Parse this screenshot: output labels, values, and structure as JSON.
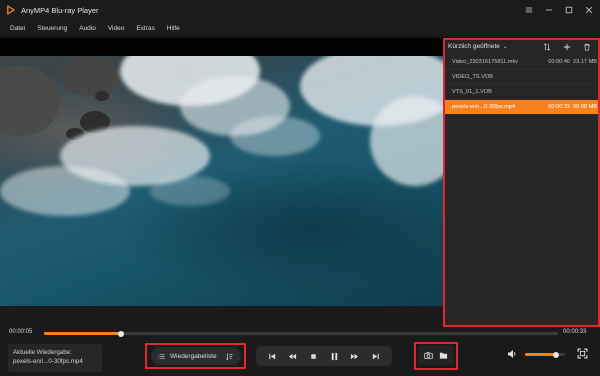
{
  "app": {
    "title": "AnyMP4 Blu-ray Player"
  },
  "menu": [
    "Datei",
    "Steuerung",
    "Audio",
    "Video",
    "Extras",
    "Hilfe"
  ],
  "playlist": {
    "title": "Kürzlich geöffnete",
    "tools": [
      "sort-icon",
      "add-icon",
      "trash-icon"
    ],
    "items": [
      {
        "name": "Video_230316175811.mkv",
        "duration": "00:00:40",
        "size": "23.17 MB",
        "active": false
      },
      {
        "name": "VIDEO_TS.VOB",
        "duration": "",
        "size": "",
        "active": false
      },
      {
        "name": "VTS_01_1.VOB",
        "duration": "",
        "size": "",
        "active": false
      },
      {
        "name": "pexels-enri...0-30fps.mp4",
        "duration": "00:00:33",
        "size": "98.08 MB",
        "active": true
      }
    ]
  },
  "player": {
    "current_time": "00:00:05",
    "total_time": "00:00:33",
    "progress": 0.15,
    "now_playing_label": "Aktuelle Wiedergabe:",
    "now_playing_file": "pexels-enri...0-30fps.mp4",
    "playlist_button_label": "Wiedergabeliste",
    "volume": 0.78
  },
  "colors": {
    "accent": "#f6821f",
    "highlight": "#e2262e",
    "background": "#1a1a1a"
  }
}
